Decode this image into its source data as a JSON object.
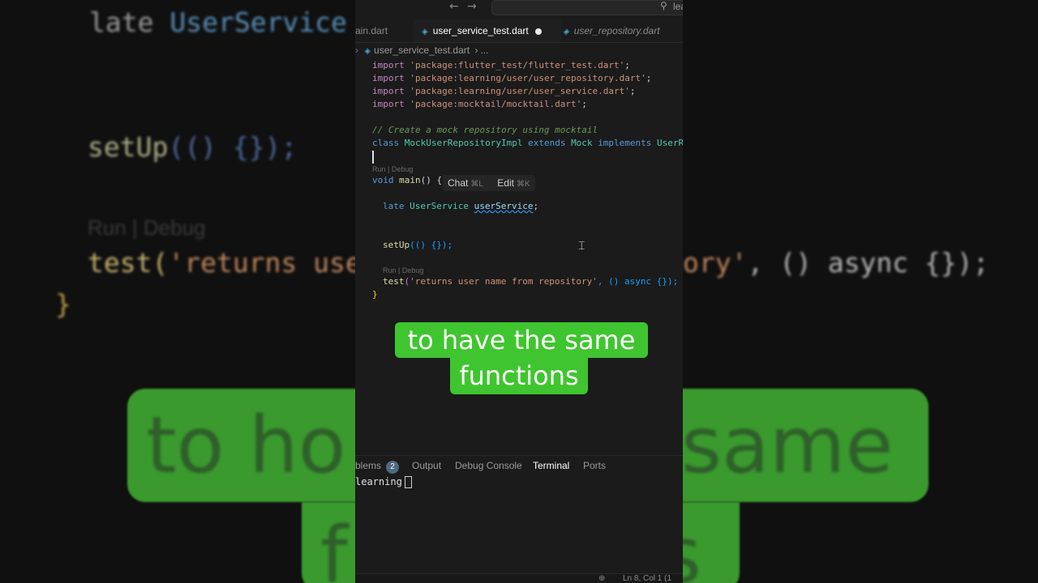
{
  "background": {
    "line1_kw": "late",
    "line1_type": "UserService",
    "line2_fn": "setUp",
    "line2_rest": "(() {});",
    "line3": "Run | Debug",
    "line4_fn": "test(",
    "line4_str": "'returns use",
    "line4r_str": "ory'",
    "line4r_rest": ", () async {});",
    "line5": "}",
    "big1": "to ho",
    "big2": "same",
    "big3": "f",
    "big4": "s"
  },
  "window": {
    "back_arrow": "←",
    "forward_arrow": "→",
    "search_text": "lea"
  },
  "tabs": [
    {
      "label": "ain.dart"
    },
    {
      "label": "user_service_test.dart"
    },
    {
      "label": "user_repository.dart"
    }
  ],
  "breadcrumb": {
    "file": "user_service_test.dart",
    "sep": "›",
    "more": "..."
  },
  "code": {
    "import_kw": "import",
    "imports": [
      "'package:flutter_test/flutter_test.dart'",
      "'package:learning/user/user_repository.dart'",
      "'package:learning/user/user_service.dart'",
      "'package:mocktail/mocktail.dart'"
    ],
    "semicolon": ";",
    "comment": "// Create a mock repository using mocktail",
    "class_kw": "class",
    "class_name": "MockUserRepositoryImpl",
    "extends_kw": "extends",
    "mock": "Mock",
    "implements_kw": "implements",
    "iface": "UserRep",
    "codelens1": "Run | Debug",
    "void_kw": "void",
    "main_fn": "main",
    "main_rest": "() {",
    "late_kw": "late",
    "late_type": "UserService",
    "late_var": "userService",
    "setup_fn": "setUp",
    "setup_rest": "(() {});",
    "codelens2": "Run | Debug",
    "test_fn": "test",
    "test_str": "'returns user name from repository'",
    "test_rest": ", () async {});",
    "close_brace": "}"
  },
  "inline_hint": {
    "chat": "Chat",
    "chat_key": "⌘L",
    "edit": "Edit",
    "edit_key": "⌘K"
  },
  "panel": {
    "tabs": [
      "blems",
      "Output",
      "Debug Console",
      "Terminal",
      "Ports"
    ],
    "problems_count": "2",
    "terminal_prompt": "learning"
  },
  "status": {
    "position": "Ln 8, Col 1 (1"
  },
  "caption": {
    "line1": "to have the same",
    "line2": "functions"
  }
}
